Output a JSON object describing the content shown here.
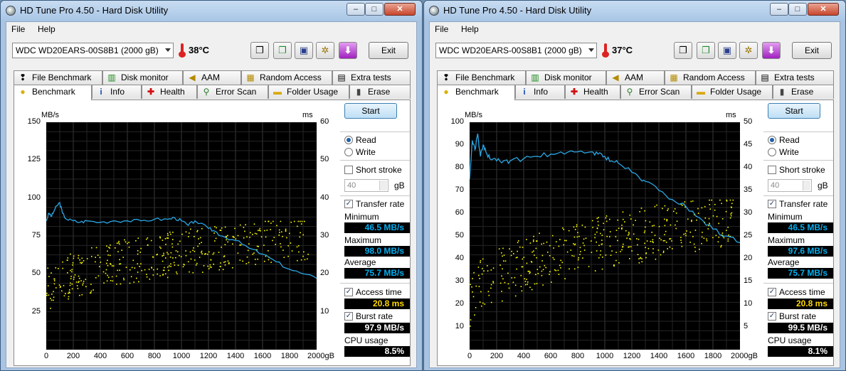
{
  "windows": [
    {
      "title": "HD Tune Pro 4.50 - Hard Disk Utility",
      "menu": [
        "File",
        "Help"
      ],
      "drive": "WDC WD20EARS-00S8B1 (2000 gB)",
      "temperature": "38°C",
      "exit_label": "Exit",
      "tabs_top": [
        "File Benchmark",
        "Disk monitor",
        "AAM",
        "Random Access",
        "Extra tests"
      ],
      "tabs_bottom": [
        "Benchmark",
        "Info",
        "Health",
        "Error Scan",
        "Folder Usage",
        "Erase"
      ],
      "active_tab": "Benchmark",
      "start_label": "Start",
      "read_label": "Read",
      "write_label": "Write",
      "mode": "Read",
      "short_stroke_label": "Short stroke",
      "short_stroke_checked": false,
      "short_stroke_value": "40",
      "short_stroke_unit": "gB",
      "transfer_rate_label": "Transfer rate",
      "transfer_rate_checked": true,
      "minimum_label": "Minimum",
      "minimum": "46.5 MB/s",
      "maximum_label": "Maximum",
      "maximum": "98.0 MB/s",
      "average_label": "Average",
      "average": "75.7 MB/s",
      "access_time_label": "Access time",
      "access_time_checked": true,
      "access_time": "20.8 ms",
      "burst_rate_label": "Burst rate",
      "burst_rate_checked": true,
      "burst_rate": "97.9 MB/s",
      "cpu_usage_label": "CPU usage",
      "cpu_usage": "8.5%",
      "chart_data": {
        "type": "line",
        "ylabel": "MB/s",
        "y2label": "ms",
        "xunit": "gB",
        "ylim": [
          0,
          150
        ],
        "y2lim": [
          0,
          60
        ],
        "xlim": [
          0,
          2000
        ],
        "yticks": [
          "150",
          "125",
          "100",
          "75",
          "50",
          "25"
        ],
        "y2ticks": [
          "60",
          "50",
          "40",
          "30",
          "20",
          "10"
        ],
        "xticks": [
          "0",
          "200",
          "400",
          "600",
          "800",
          "1000",
          "1200",
          "1400",
          "1600",
          "1800",
          "2000gB"
        ],
        "series": [
          {
            "x": [
              0,
              20,
              40,
              60,
              80,
              100,
              120,
              150,
              200,
              250,
              300,
              400,
              500,
              600,
              700,
              800,
              900,
              950,
              1000,
              1050,
              1100,
              1200,
              1250,
              1300,
              1400,
              1500,
              1600,
              1700,
              1800,
              1900,
              2000
            ],
            "values": [
              85,
              90,
              88,
              92,
              95,
              97,
              90,
              86,
              85,
              84,
              85,
              84,
              85,
              85,
              85,
              86,
              86,
              87,
              85,
              82,
              85,
              80,
              78,
              75,
              72,
              67,
              63,
              58,
              53,
              50,
              47
            ]
          }
        ],
        "access_points": {
          "color": "#ffff00",
          "x_start": 0,
          "x_end": 1950,
          "ms_min": 9,
          "ms_max": 34
        },
        "grid": true
      }
    },
    {
      "title": "HD Tune Pro 4.50 - Hard Disk Utility",
      "menu": [
        "File",
        "Help"
      ],
      "drive": "WDC WD20EARS-00S8B1 (2000 gB)",
      "temperature": "37°C",
      "exit_label": "Exit",
      "tabs_top": [
        "File Benchmark",
        "Disk monitor",
        "AAM",
        "Random Access",
        "Extra tests"
      ],
      "tabs_bottom": [
        "Benchmark",
        "Info",
        "Health",
        "Error Scan",
        "Folder Usage",
        "Erase"
      ],
      "active_tab": "Benchmark",
      "start_label": "Start",
      "read_label": "Read",
      "write_label": "Write",
      "mode": "Read",
      "short_stroke_label": "Short stroke",
      "short_stroke_checked": false,
      "short_stroke_value": "40",
      "short_stroke_unit": "gB",
      "transfer_rate_label": "Transfer rate",
      "transfer_rate_checked": true,
      "minimum_label": "Minimum",
      "minimum": "46.5 MB/s",
      "maximum_label": "Maximum",
      "maximum": "97.6 MB/s",
      "average_label": "Average",
      "average": "75.7 MB/s",
      "access_time_label": "Access time",
      "access_time_checked": true,
      "access_time": "20.8 ms",
      "burst_rate_label": "Burst rate",
      "burst_rate_checked": true,
      "burst_rate": "99.5 MB/s",
      "cpu_usage_label": "CPU usage",
      "cpu_usage": "8.1%",
      "chart_data": {
        "type": "line",
        "ylabel": "MB/s",
        "y2label": "ms",
        "xunit": "gB",
        "ylim": [
          0,
          100
        ],
        "y2lim": [
          0,
          50
        ],
        "xlim": [
          0,
          2000
        ],
        "yticks": [
          "100",
          "90",
          "80",
          "70",
          "60",
          "50",
          "40",
          "30",
          "20",
          "10"
        ],
        "y2ticks": [
          "50",
          "45",
          "40",
          "35",
          "30",
          "25",
          "20",
          "15",
          "10",
          "5"
        ],
        "xticks": [
          "0",
          "200",
          "400",
          "600",
          "800",
          "1000",
          "1200",
          "1400",
          "1600",
          "1800",
          "2000gB"
        ],
        "series": [
          {
            "x": [
              0,
              20,
              40,
              60,
              80,
              100,
              120,
              150,
              200,
              250,
              300,
              400,
              500,
              600,
              700,
              800,
              900,
              950,
              1000,
              1050,
              1100,
              1200,
              1250,
              1300,
              1400,
              1500,
              1600,
              1700,
              1800,
              1900,
              2000
            ],
            "values": [
              75,
              92,
              88,
              95,
              85,
              90,
              87,
              84,
              83,
              83,
              83,
              84,
              85,
              86,
              86,
              87,
              87,
              86,
              85,
              83,
              82,
              78,
              76,
              74,
              70,
              66,
              63,
              58,
              53,
              50,
              47
            ]
          }
        ],
        "access_points": {
          "color": "#ffff00",
          "x_start": 0,
          "x_end": 1950,
          "ms_min": 4,
          "ms_max": 33
        },
        "grid": true
      }
    }
  ]
}
